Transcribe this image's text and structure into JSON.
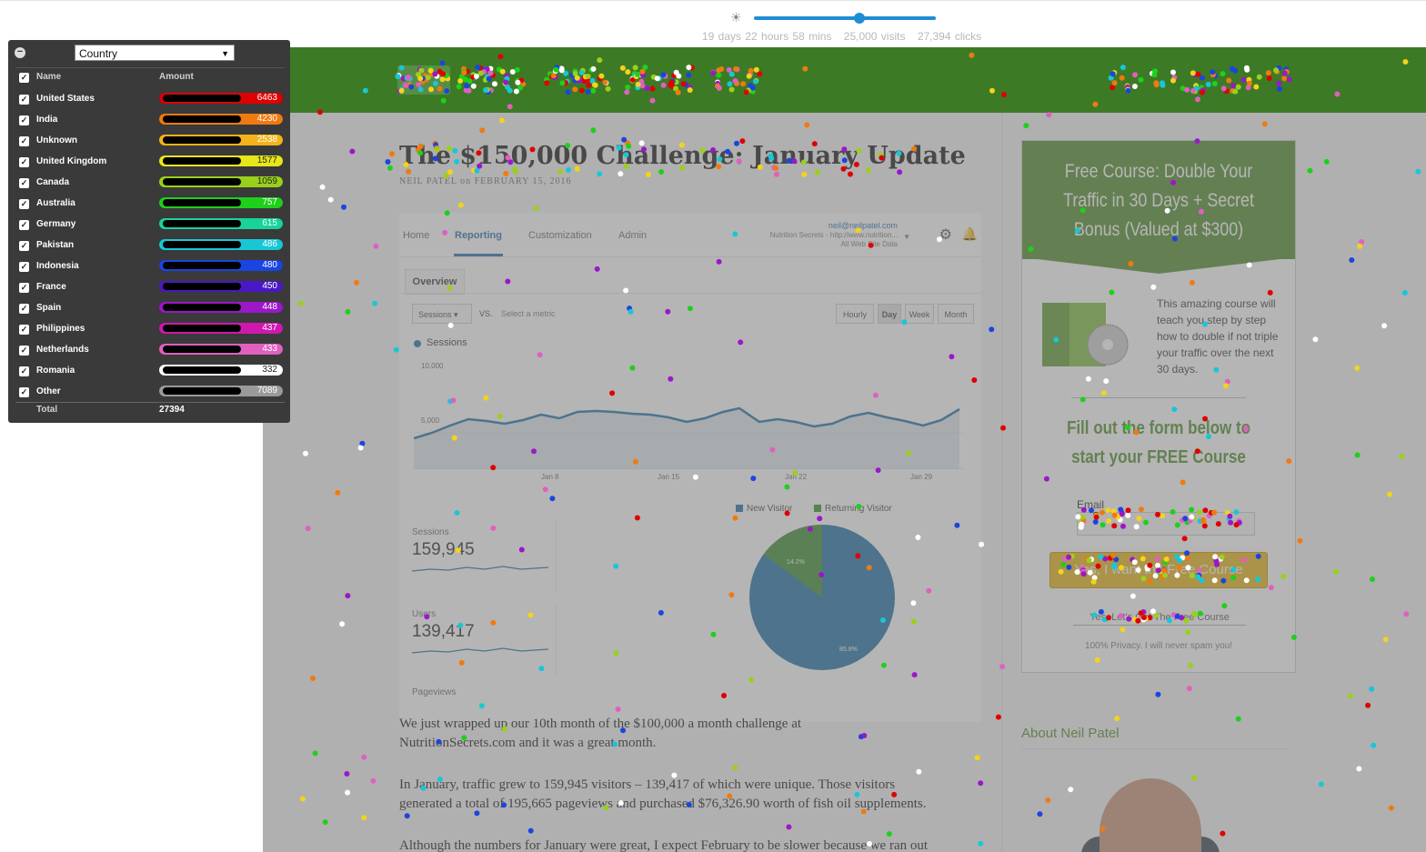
{
  "topbar": {
    "duration": "19 days 22 hours 58 mins",
    "visits": "25,000 visits",
    "clicks": "27,394 clicks",
    "brightness_icon": "sun-icon",
    "slider_value": 0.58
  },
  "panel": {
    "dimension": "Country",
    "col_name": "Name",
    "col_amount": "Amount",
    "total_label": "Total",
    "total_value": "27394",
    "rows": [
      {
        "name": "United States",
        "amount": "6463",
        "color": "#e00000"
      },
      {
        "name": "India",
        "amount": "4230",
        "color": "#f07a10"
      },
      {
        "name": "Unknown",
        "amount": "2538",
        "color": "#f4b31a"
      },
      {
        "name": "United Kingdom",
        "amount": "1577",
        "color": "#e6e619"
      },
      {
        "name": "Canada",
        "amount": "1059",
        "color": "#9ad01a"
      },
      {
        "name": "Australia",
        "amount": "757",
        "color": "#1ed01a"
      },
      {
        "name": "Germany",
        "amount": "615",
        "color": "#18d39a"
      },
      {
        "name": "Pakistan",
        "amount": "486",
        "color": "#18c7d6"
      },
      {
        "name": "Indonesia",
        "amount": "480",
        "color": "#1a45e0"
      },
      {
        "name": "France",
        "amount": "450",
        "color": "#4a18c6"
      },
      {
        "name": "Spain",
        "amount": "448",
        "color": "#9a18c8"
      },
      {
        "name": "Philippines",
        "amount": "437",
        "color": "#d018b0"
      },
      {
        "name": "Netherlands",
        "amount": "433",
        "color": "#e060c0"
      },
      {
        "name": "Romania",
        "amount": "332",
        "color": "#ffffff"
      },
      {
        "name": "Other",
        "amount": "7089",
        "color": "#9a9a9a"
      }
    ]
  },
  "article": {
    "title": "The $150,000 Challenge: January Update",
    "byline": "NEIL PATEL on FEBRUARY 15, 2016",
    "p1_line1": "We just wrapped up our 10th month of the $100,000 a month challenge at",
    "p1_line2": "NutritionSecrets.com and it was a great month.",
    "p2_line1": "In January, traffic grew to 159,945 visitors – 139,417 of which were unique. Those visitors",
    "p2_line2": "generated a total of 195,665 pageviews and purchased $76,326.90 worth of fish oil supplements.",
    "p3_line1": "Although the numbers for January were great, I expect February to be slower because we ran out"
  },
  "analytics": {
    "tabs": [
      "Home",
      "Reporting",
      "Customization",
      "Admin"
    ],
    "email": "neil@neilpatel.com",
    "site_line1": "Nutrition Secrets - http://www.nutrition...",
    "site_line2": "All Web Site Data",
    "overview": "Overview",
    "metric_select": "Sessions",
    "vs": "VS.",
    "select_metric": "Select a metric",
    "periods": [
      "Hourly",
      "Day",
      "Week",
      "Month"
    ],
    "legend": "Sessions",
    "y_top": "10,000",
    "y_mid": "5,000",
    "x_labels": [
      "Jan 8",
      "Jan 15",
      "Jan 22",
      "Jan 29"
    ],
    "sessions_label": "Sessions",
    "sessions_value": "159,945",
    "users_label": "Users",
    "users_value": "139,417",
    "pageviews_label": "Pageviews",
    "pie_new": "New Visitor",
    "pie_returning": "Returning Visitor",
    "pie_new_pct": "85.8%",
    "pie_returning_pct": "14.2%"
  },
  "sidebar": {
    "optin_title": "Free Course: Double Your Traffic in 30 Days + Secret Bonus (Valued at $300)",
    "optin_desc": "This amazing course will teach you step by step how to double if not triple your traffic over the next 30 days.",
    "optin_cta": "Fill out the form below to start your FREE Course",
    "email_label": "Email",
    "button": "Yes, I want the Free Course",
    "link": "Yes, Let's Get The Free Course",
    "privacy": "100% Privacy. I will never spam you!",
    "about": "About Neil Patel"
  }
}
